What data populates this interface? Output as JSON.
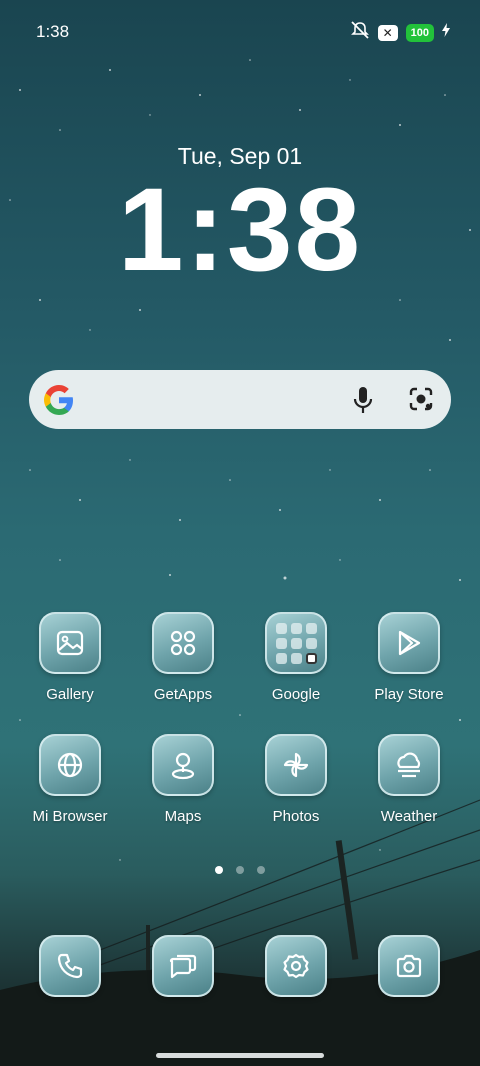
{
  "status_bar": {
    "time": "1:38",
    "battery": "100",
    "icons": [
      "mute-icon",
      "x-notification-icon",
      "battery-icon",
      "charging-icon"
    ]
  },
  "lock_widget": {
    "date": "Tue, Sep 01",
    "time": "1:38"
  },
  "search_bar": {
    "icons": [
      "google-g-icon",
      "microphone-icon",
      "lens-camera-icon"
    ]
  },
  "apps_row1": [
    {
      "label": "Gallery",
      "icon": "gallery-icon"
    },
    {
      "label": "GetApps",
      "icon": "getapps-icon"
    },
    {
      "label": "Google",
      "icon": "folder-icon"
    },
    {
      "label": "Play Store",
      "icon": "play-store-icon"
    }
  ],
  "apps_row2": [
    {
      "label": "Mi Browser",
      "icon": "globe-icon"
    },
    {
      "label": "Maps",
      "icon": "map-pin-icon"
    },
    {
      "label": "Photos",
      "icon": "pinwheel-icon"
    },
    {
      "label": "Weather",
      "icon": "weather-icon"
    }
  ],
  "dock": [
    {
      "icon": "phone-icon"
    },
    {
      "icon": "messages-icon"
    },
    {
      "icon": "settings-icon"
    },
    {
      "icon": "camera-icon"
    }
  ],
  "pager": {
    "pages": 3,
    "current": 1
  },
  "colors": {
    "battery": "#22c23a",
    "tile": "#6fa4ab"
  }
}
